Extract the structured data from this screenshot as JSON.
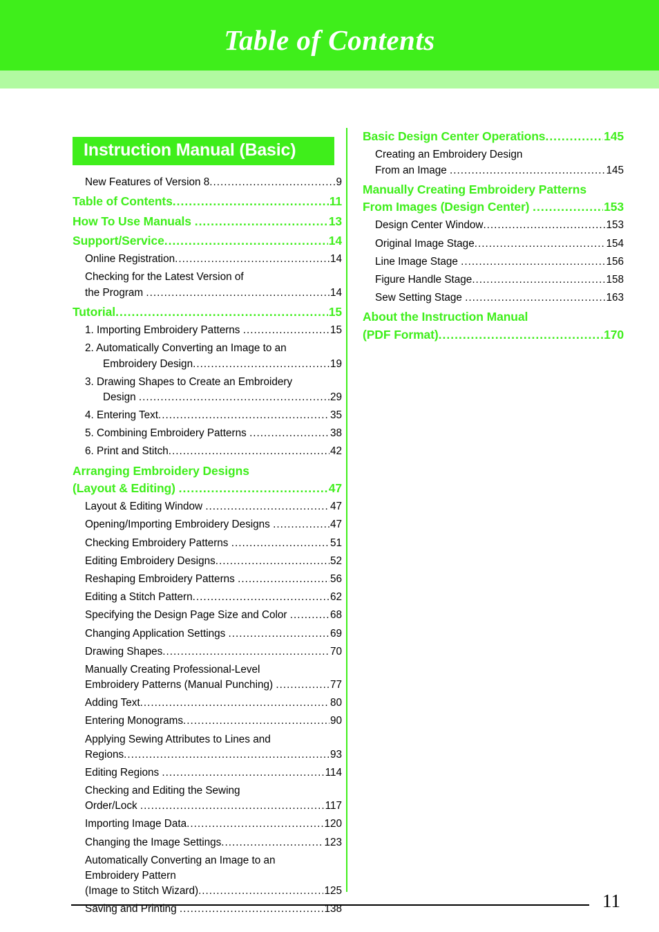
{
  "header": {
    "title": "Table of Contents"
  },
  "footer": {
    "page_number": "11"
  },
  "colors": {
    "accent_green": "#3FEE1B",
    "strip_green": "#B1FAA1",
    "text_black": "#000000",
    "white": "#FFFFFF"
  },
  "left_column": {
    "section_title": "Instruction Manual (Basic)",
    "entries": [
      {
        "level": 2,
        "lines": [
          "New Features of Version 8"
        ],
        "page": "9"
      },
      {
        "level": 1,
        "lines": [
          "Table of Contents"
        ],
        "page": "11"
      },
      {
        "level": 1,
        "lines": [
          "How To Use Manuals "
        ],
        "page": "13"
      },
      {
        "level": 1,
        "lines": [
          "Support/Service"
        ],
        "page": "14"
      },
      {
        "level": 2,
        "lines": [
          "Online Registration"
        ],
        "page": "14"
      },
      {
        "level": 2,
        "lines": [
          "Checking for the Latest Version of",
          "the Program "
        ],
        "page": "14"
      },
      {
        "level": 1,
        "lines": [
          "Tutorial"
        ],
        "page": "15"
      },
      {
        "level": 2,
        "lines": [
          "1. Importing Embroidery Patterns "
        ],
        "page": "15"
      },
      {
        "level": 2,
        "lines": [
          "2. Automatically Converting an Image to an",
          "Embroidery Design"
        ],
        "page": "19",
        "hang": true
      },
      {
        "level": 2,
        "lines": [
          "3. Drawing Shapes to Create an Embroidery",
          "Design "
        ],
        "page": "29",
        "hang": true
      },
      {
        "level": 2,
        "lines": [
          "4. Entering Text"
        ],
        "page": "35"
      },
      {
        "level": 2,
        "lines": [
          "5. Combining Embroidery Patterns "
        ],
        "page": "38"
      },
      {
        "level": 2,
        "lines": [
          "6. Print and Stitch"
        ],
        "page": "42"
      },
      {
        "level": 1,
        "lines": [
          "Arranging Embroidery Designs",
          "(Layout & Editing) "
        ],
        "page": "47"
      },
      {
        "level": 2,
        "lines": [
          "Layout & Editing Window "
        ],
        "page": "47"
      },
      {
        "level": 2,
        "lines": [
          "Opening/Importing Embroidery Designs "
        ],
        "page": "47"
      },
      {
        "level": 2,
        "lines": [
          "Checking Embroidery Patterns "
        ],
        "page": "51"
      },
      {
        "level": 2,
        "lines": [
          "Editing Embroidery Designs"
        ],
        "page": "52"
      },
      {
        "level": 2,
        "lines": [
          "Reshaping Embroidery Patterns "
        ],
        "page": "56"
      },
      {
        "level": 2,
        "lines": [
          "Editing a Stitch Pattern"
        ],
        "page": "62"
      },
      {
        "level": 2,
        "lines": [
          "Specifying the Design Page Size and Color "
        ],
        "page": "68"
      },
      {
        "level": 2,
        "lines": [
          "Changing Application Settings "
        ],
        "page": "69"
      },
      {
        "level": 2,
        "lines": [
          "Drawing Shapes"
        ],
        "page": "70"
      },
      {
        "level": 2,
        "lines": [
          "Manually Creating Professional-Level",
          "Embroidery Patterns (Manual Punching) "
        ],
        "page": "77"
      },
      {
        "level": 2,
        "lines": [
          "Adding Text"
        ],
        "page": "80"
      },
      {
        "level": 2,
        "lines": [
          "Entering Monograms"
        ],
        "page": "90"
      },
      {
        "level": 2,
        "lines": [
          "Applying Sewing Attributes to Lines and",
          "Regions"
        ],
        "page": "93"
      },
      {
        "level": 2,
        "lines": [
          "Editing Regions "
        ],
        "page": "114"
      },
      {
        "level": 2,
        "lines": [
          "Checking and Editing the Sewing",
          "Order/Lock "
        ],
        "page": "117"
      },
      {
        "level": 2,
        "lines": [
          "Importing Image Data"
        ],
        "page": "120"
      },
      {
        "level": 2,
        "lines": [
          "Changing the Image Settings"
        ],
        "page": "123"
      },
      {
        "level": 2,
        "lines": [
          "Automatically Converting an Image to an",
          "Embroidery Pattern",
          "(Image to Stitch Wizard)"
        ],
        "page": "125"
      },
      {
        "level": 2,
        "lines": [
          "Saving and Printing "
        ],
        "page": "138"
      }
    ]
  },
  "right_column": {
    "entries": [
      {
        "level": 1,
        "lines": [
          "Basic Design Center Operations"
        ],
        "page": "145"
      },
      {
        "level": 2,
        "lines": [
          "Creating an Embroidery Design",
          "From an Image "
        ],
        "page": "145"
      },
      {
        "level": 1,
        "lines": [
          "Manually Creating Embroidery Patterns",
          "From Images (Design Center) "
        ],
        "page": "153"
      },
      {
        "level": 2,
        "lines": [
          "Design Center Window"
        ],
        "page": "153"
      },
      {
        "level": 2,
        "lines": [
          "Original Image Stage"
        ],
        "page": "154"
      },
      {
        "level": 2,
        "lines": [
          "Line Image Stage "
        ],
        "page": "156"
      },
      {
        "level": 2,
        "lines": [
          "Figure Handle Stage"
        ],
        "page": "158"
      },
      {
        "level": 2,
        "lines": [
          "Sew Setting Stage "
        ],
        "page": "163"
      },
      {
        "level": 1,
        "lines": [
          "About the Instruction Manual",
          "(PDF Format)"
        ],
        "page": "170"
      }
    ]
  }
}
